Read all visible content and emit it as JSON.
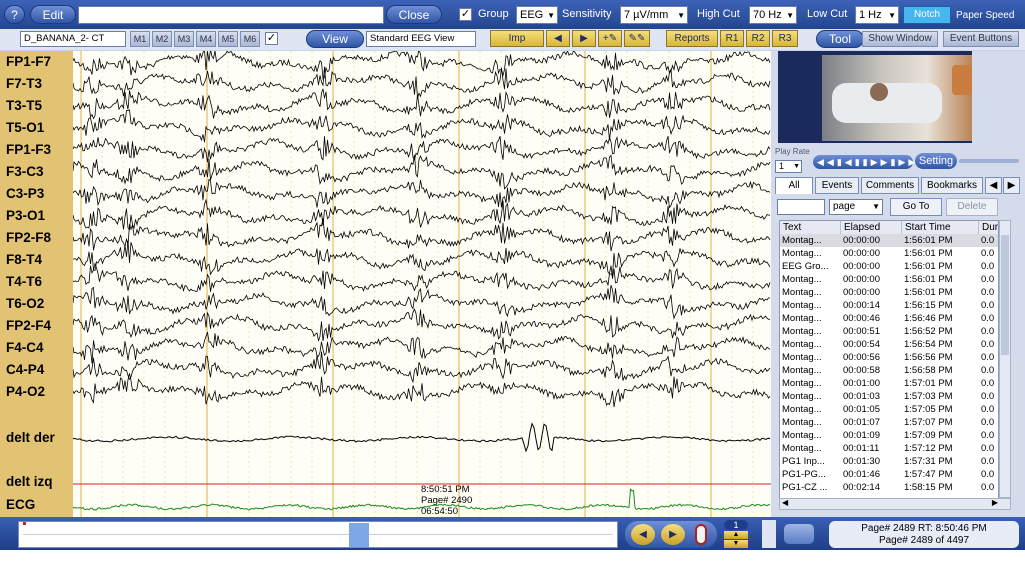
{
  "toolbar1": {
    "help_label": "?",
    "edit_label": "Edit",
    "edit_value": "",
    "close_label": "Close",
    "group_label": "Group",
    "group_value": "EEG",
    "sensitivity_label": "Sensitivity",
    "sensitivity_value": "7 µV/mm",
    "highcut_label": "High Cut",
    "highcut_value": "70 Hz",
    "lowcut_label": "Low Cut",
    "lowcut_value": "1 Hz",
    "notch_label": "Notch",
    "paper_speed_label": "Paper Speed"
  },
  "toolbar2": {
    "montage_value": "D_BANANA_2- CT",
    "montage_buttons": [
      "M1",
      "M2",
      "M3",
      "M4",
      "M5",
      "M6"
    ],
    "view_label": "View",
    "view_value": "Standard EEG View",
    "imp_label": "Imp",
    "reports_label": "Reports",
    "r_buttons": [
      "R1",
      "R2",
      "R3"
    ],
    "tool_label": "Tool",
    "show_window_label": "Show Window",
    "event_buttons_label": "Event Buttons"
  },
  "channels": [
    "FP1-F7",
    "F7-T3",
    "T3-T5",
    "T5-O1",
    "FP1-F3",
    "F3-C3",
    "C3-P3",
    "P3-O1",
    "FP2-F8",
    "F8-T4",
    "T4-T6",
    "T6-O2",
    "FP2-F4",
    "F4-C4",
    "C4-P4",
    "P4-O2",
    "delt der",
    "delt izq",
    "ECG"
  ],
  "overlay": {
    "time": "8:50:51 PM",
    "page": "Page# 2490",
    "elapsed": "06:54:50"
  },
  "video_controls": {
    "settings_label": "Setting",
    "speed_value": "1",
    "speed_label": "Play Rate"
  },
  "events_panel": {
    "tabs": [
      "All",
      "Events",
      "Comments",
      "Bookmarks"
    ],
    "goto_input": "",
    "unit_value": "page",
    "goto_label": "Go To",
    "delete_label": "Delete",
    "columns": [
      "Text",
      "Elapsed",
      "Start Time",
      "Dur"
    ],
    "rows": [
      [
        "Montag...",
        "00:00:00",
        "1:56:01 PM",
        "0.0"
      ],
      [
        "Montag...",
        "00:00:00",
        "1:56:01 PM",
        "0.0"
      ],
      [
        "EEG Gro...",
        "00:00:00",
        "1:56:01 PM",
        "0.0"
      ],
      [
        "Montag...",
        "00:00:00",
        "1:56:01 PM",
        "0.0"
      ],
      [
        "Montag...",
        "00:00:00",
        "1:56:01 PM",
        "0.0"
      ],
      [
        "Montag...",
        "00:00:14",
        "1:56:15 PM",
        "0.0"
      ],
      [
        "Montag...",
        "00:00:46",
        "1:56:46 PM",
        "0.0"
      ],
      [
        "Montag...",
        "00:00:51",
        "1:56:52 PM",
        "0.0"
      ],
      [
        "Montag...",
        "00:00:54",
        "1:56:54 PM",
        "0.0"
      ],
      [
        "Montag...",
        "00:00:56",
        "1:56:56 PM",
        "0.0"
      ],
      [
        "Montag...",
        "00:00:58",
        "1:56:58 PM",
        "0.0"
      ],
      [
        "Montag...",
        "00:01:00",
        "1:57:01 PM",
        "0.0"
      ],
      [
        "Montag...",
        "00:01:03",
        "1:57:03 PM",
        "0.0"
      ],
      [
        "Montag...",
        "00:01:05",
        "1:57:05 PM",
        "0.0"
      ],
      [
        "Montag...",
        "00:01:07",
        "1:57:07 PM",
        "0.0"
      ],
      [
        "Montag...",
        "00:01:09",
        "1:57:09 PM",
        "0.0"
      ],
      [
        "Montag...",
        "00:01:11",
        "1:57:12 PM",
        "0.0"
      ],
      [
        "PG1 Inp...",
        "00:01:30",
        "1:57:31 PM",
        "0.0"
      ],
      [
        "PG1-PG...",
        "00:01:46",
        "1:57:47 PM",
        "0.0"
      ],
      [
        "PG1-CZ ...",
        "00:02:14",
        "1:58:15 PM",
        "0.0"
      ]
    ]
  },
  "bottom": {
    "page_counter": "1",
    "page_rt": "Page# 2489  RT: 8:50:46 PM",
    "page_of": "Page# 2489 of 4497"
  },
  "colors": {
    "toolbar": "#2f55a6",
    "label_bg": "#e2c374",
    "trace": "#000000",
    "ecg": "#1a8a1a",
    "delt_izq": "#d42020",
    "gridline": "#e8c96a"
  }
}
